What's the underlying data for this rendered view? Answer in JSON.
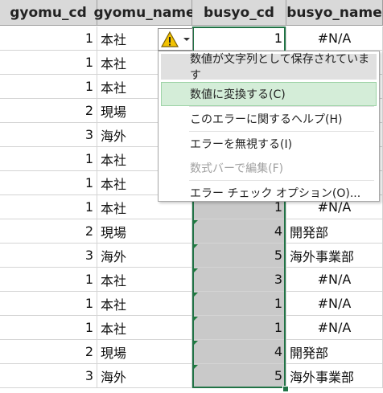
{
  "headers": [
    "gyomu_cd",
    "gyomu_name",
    "busyo_cd",
    "busyo_name"
  ],
  "rows": [
    [
      "1",
      "本社",
      "1",
      "#N/A"
    ],
    [
      "1",
      "本社",
      "",
      ""
    ],
    [
      "1",
      "本社",
      "",
      ""
    ],
    [
      "2",
      "現場",
      "",
      ""
    ],
    [
      "3",
      "海外",
      "",
      ""
    ],
    [
      "1",
      "本社",
      "",
      ""
    ],
    [
      "1",
      "本社",
      "",
      ""
    ],
    [
      "1",
      "本社",
      "1",
      "#N/A"
    ],
    [
      "2",
      "現場",
      "4",
      "開発部"
    ],
    [
      "3",
      "海外",
      "5",
      "海外事業部"
    ],
    [
      "1",
      "本社",
      "3",
      "#N/A"
    ],
    [
      "1",
      "本社",
      "1",
      "#N/A"
    ],
    [
      "1",
      "本社",
      "1",
      "#N/A"
    ],
    [
      "2",
      "現場",
      "4",
      "開発部"
    ],
    [
      "3",
      "海外",
      "5",
      "海外事業部"
    ]
  ],
  "error_button": {
    "icon": "warning-icon"
  },
  "menu": {
    "header": "数値が文字列として保存されています",
    "items": [
      {
        "label": "数値に変換する(C)",
        "highlighted": true,
        "disabled": false
      },
      {
        "label": "このエラーに関するヘルプ(H)",
        "highlighted": false,
        "disabled": false
      },
      {
        "label": "エラーを無視する(I)",
        "highlighted": false,
        "disabled": false
      },
      {
        "label": "数式バーで編集(F)",
        "highlighted": false,
        "disabled": true
      },
      {
        "label": "エラー チェック オプション(O)...",
        "highlighted": false,
        "disabled": false
      }
    ]
  },
  "colors": {
    "selection_border": "#217346",
    "selected_fill": "#c9c9c9",
    "highlight": "#d4edd8"
  }
}
